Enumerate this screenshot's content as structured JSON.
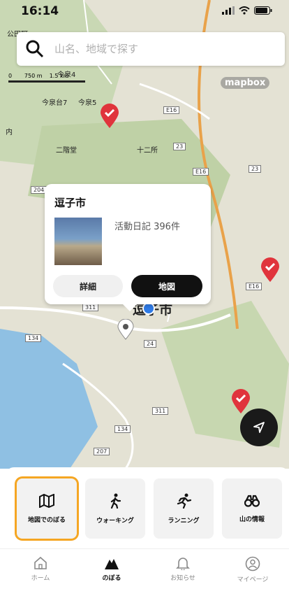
{
  "status_bar": {
    "time": "16:14"
  },
  "search": {
    "placeholder": "山名、地域で探す"
  },
  "map": {
    "attribution": "mapbox",
    "city_label": "逗子市",
    "scale_labels": [
      "0",
      "750 m",
      "1.5 km"
    ],
    "place_labels": [
      "公田町",
      "今泉4",
      "今泉台7",
      "今泉5",
      "二階堂",
      "十二所",
      "内"
    ],
    "road_labels": [
      "E16",
      "23",
      "E16",
      "23",
      "204",
      "311",
      "134",
      "24",
      "E16",
      "311",
      "134",
      "207"
    ]
  },
  "popup": {
    "title": "逗子市",
    "count_text": "活動日記 396件",
    "detail_button": "詳細",
    "map_button": "地図"
  },
  "categories": [
    {
      "label": "地図でのぼる",
      "icon": "map-icon",
      "selected": true
    },
    {
      "label": "ウォーキング",
      "icon": "walking-icon",
      "selected": false
    },
    {
      "label": "ランニング",
      "icon": "running-icon",
      "selected": false
    },
    {
      "label": "山の情報",
      "icon": "binoculars-icon",
      "selected": false
    }
  ],
  "tabs": [
    {
      "label": "ホーム",
      "icon": "home-icon",
      "active": false
    },
    {
      "label": "のぼる",
      "icon": "mountain-icon",
      "active": true
    },
    {
      "label": "お知らせ",
      "icon": "bell-icon",
      "active": false
    },
    {
      "label": "マイページ",
      "icon": "user-icon",
      "active": false
    }
  ],
  "colors": {
    "accent": "#f5a623",
    "pin_red": "#e0343c",
    "dark": "#111111"
  }
}
